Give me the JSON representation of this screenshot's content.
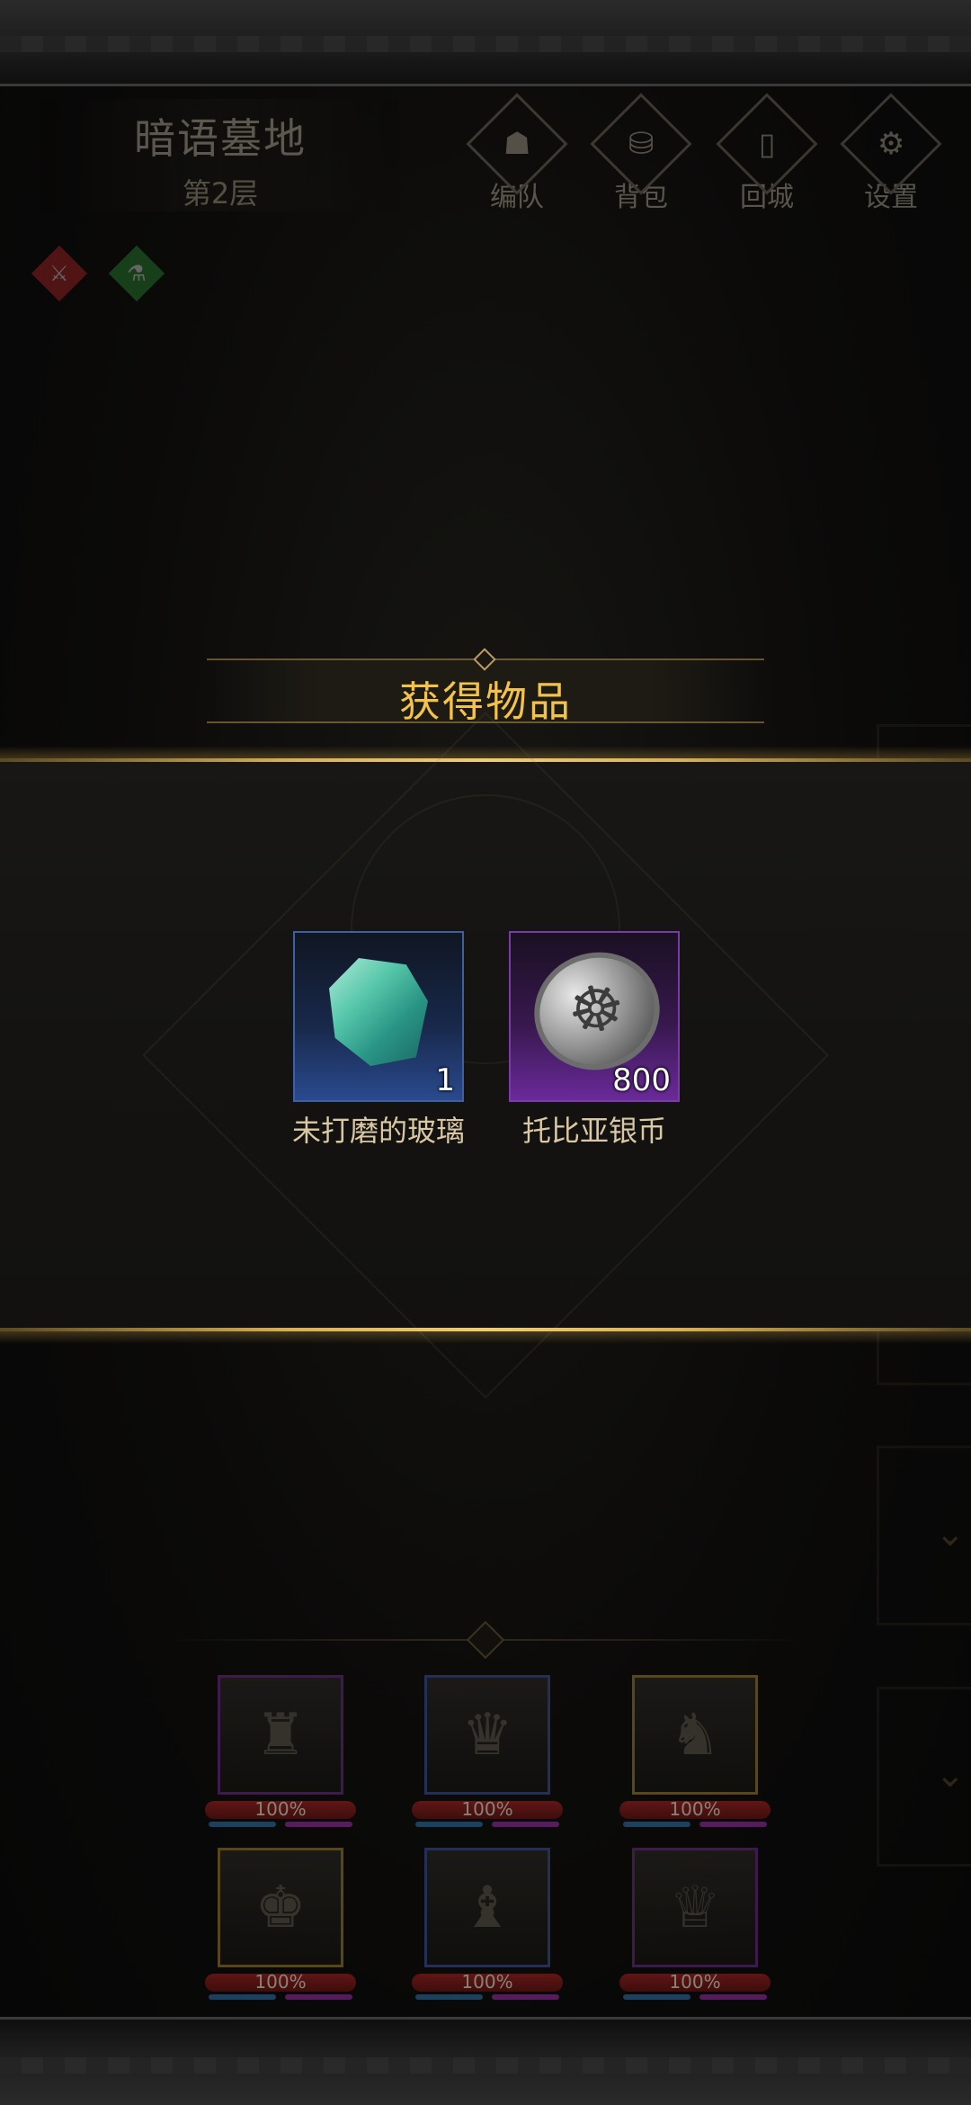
{
  "header": {
    "location_name": "暗语墓地",
    "floor": "第2层"
  },
  "top_menu": [
    {
      "label": "编队",
      "icon": "helmet-icon"
    },
    {
      "label": "背包",
      "icon": "backpack-icon"
    },
    {
      "label": "回城",
      "icon": "door-icon"
    },
    {
      "label": "设置",
      "icon": "gear-icon"
    }
  ],
  "buffs": [
    {
      "icon": "sword-buff-icon",
      "color": "#c62a2a"
    },
    {
      "icon": "potion-buff-icon",
      "color": "#2f9a3a"
    }
  ],
  "reward_popup": {
    "title": "获得物品",
    "items": [
      {
        "name": "未打磨的玻璃",
        "quantity": "1",
        "rarity_color": "#3f5f9f",
        "icon": "glass-crystal-icon"
      },
      {
        "name": "托比亚银币",
        "quantity": "800",
        "rarity_color": "#7a3aa8",
        "icon": "silver-coin-icon"
      }
    ]
  },
  "party": [
    {
      "hp": "100%",
      "rarity": "purple",
      "icon": "knight-helmet-portrait"
    },
    {
      "hp": "100%",
      "rarity": "blue",
      "icon": "blonde-heroine-portrait"
    },
    {
      "hp": "100%",
      "rarity": "gold",
      "icon": "bear-warrior-portrait"
    },
    {
      "hp": "100%",
      "rarity": "gold",
      "icon": "young-swordsman-portrait"
    },
    {
      "hp": "100%",
      "rarity": "blue",
      "icon": "hooded-ranger-portrait"
    },
    {
      "hp": "100%",
      "rarity": "purple",
      "icon": "circlet-mage-portrait"
    }
  ]
}
